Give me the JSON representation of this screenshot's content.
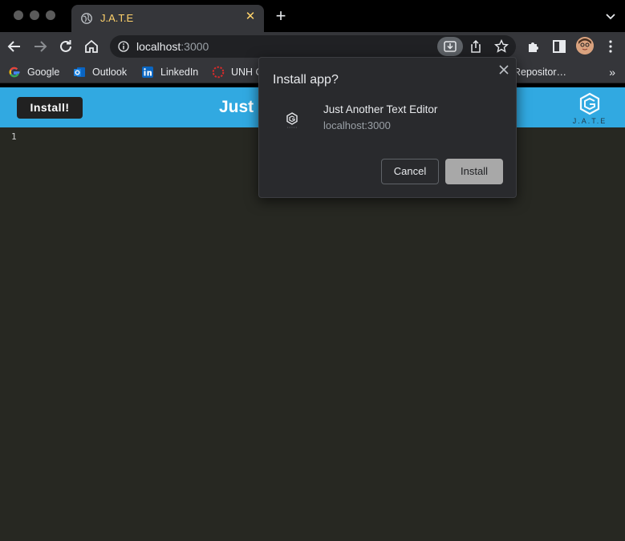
{
  "browser": {
    "tab": {
      "title": "J.A.T.E",
      "close": "✕"
    },
    "new_tab": "+",
    "omnibox": {
      "host": "localhost",
      "port": ":3000"
    },
    "bookmarks": [
      {
        "label": "Google",
        "icon": "google-icon"
      },
      {
        "label": "Outlook",
        "icon": "outlook-icon"
      },
      {
        "label": "LinkedIn",
        "icon": "linkedin-icon"
      },
      {
        "label": "UNH C",
        "icon": "unh-icon"
      },
      {
        "label": "Repositor…",
        "icon": "github-icon"
      }
    ],
    "bookmarks_overflow": "»"
  },
  "app": {
    "install_label": "Install!",
    "title": "Just",
    "logo_text": "J.A.T.E",
    "header_color": "#31a9e1",
    "editor_bg": "#272822",
    "line_number": "1"
  },
  "dialog": {
    "title": "Install app?",
    "app_name": "Just Another Text Editor",
    "app_origin": "localhost:3000",
    "cancel_label": "Cancel",
    "install_label": "Install"
  }
}
